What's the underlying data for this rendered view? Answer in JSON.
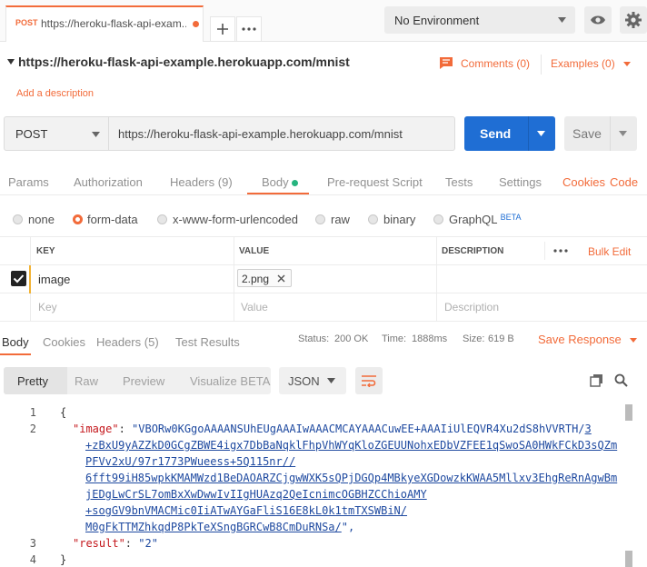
{
  "tabbar": {
    "tab_method": "POST",
    "tab_title": "https://heroku-flask-api-exam...",
    "environment": "No Environment"
  },
  "request": {
    "url_title": "https://heroku-flask-api-example.herokuapp.com/mnist",
    "add_description": "Add a description",
    "comments": "Comments (0)",
    "examples": "Examples (0)",
    "method": "POST",
    "url": "https://heroku-flask-api-example.herokuapp.com/mnist",
    "send": "Send",
    "save": "Save"
  },
  "req_tabs": {
    "params": "Params",
    "authorization": "Authorization",
    "headers": "Headers",
    "headers_count": "(9)",
    "body": "Body",
    "prerequest": "Pre-request Script",
    "tests": "Tests",
    "settings": "Settings",
    "cookies": "Cookies",
    "code": "Code"
  },
  "body_modes": {
    "none": "none",
    "form_data": "form-data",
    "urlencoded": "x-www-form-urlencoded",
    "raw": "raw",
    "binary": "binary",
    "graphql": "GraphQL",
    "beta": "BETA",
    "selected": "form-data"
  },
  "kv_table": {
    "headers": {
      "key": "KEY",
      "value": "VALUE",
      "description": "DESCRIPTION",
      "bulk_edit": "Bulk Edit"
    },
    "rows": [
      {
        "key": "image",
        "value": "2.png",
        "checked": true
      }
    ],
    "placeholder": {
      "key": "Key",
      "value": "Value",
      "description": "Description"
    }
  },
  "response": {
    "tabs": {
      "body": "Body",
      "cookies": "Cookies",
      "headers": "Headers",
      "headers_count": "(5)",
      "test_results": "Test Results"
    },
    "status_label": "Status:",
    "status": "200 OK",
    "time_label": "Time:",
    "time": "1888ms",
    "size_label": "Size:",
    "size": "619 B",
    "save_response": "Save Response",
    "views": {
      "pretty": "Pretty",
      "raw": "Raw",
      "preview": "Preview",
      "visualize": "Visualize",
      "beta": "BETA"
    },
    "format": "JSON"
  },
  "code": {
    "line_numbers": [
      "1",
      "2",
      "3",
      "4"
    ],
    "open_brace": "{",
    "close_brace": "}",
    "image_key": "\"image\"",
    "image_val_first": "\"VBORw0KGgoAAAANSUhEUgAAAIwAAACMCAYAAACuwEE+AAAIiUlEQVR4Xu2dS8hVVRTH/",
    "image_val_first_link": "3",
    "image_val_lines": [
      "+zBxU9yAZZkD0GCgZBWE4igx7DbBaNqklFhpVhWYqKloZGEUUNohxEDbVZFEE1qSwoSA0HWkFCkD3sQZm",
      "PFVv2xU/97r1773PWueess+5Q115nr//",
      "6fft99iH85wpkKMAMWzd1BeDAOARZCjgwWXK5sQPjDGQp4MBkyeXGDowzkKWAA5Mllxv3EhgReRnAgwBm",
      "jEDgLwCrSL7omBxXwDwwIvIIgHUAzq2QeIcnimcOGBHZCChioAMY",
      "+sogGV9bnVMACMic0IiATwAYGaFliS16E8kL0k1tmTXSWBiN/",
      "M0gFkTTMZhkqdP8PkTeXSngBGRCwB8CmDuRNSa/"
    ],
    "image_val_end": "\",",
    "result_key": "\"result\"",
    "result_val": "\"2\""
  },
  "colors": {
    "accent": "#f26b3a",
    "send_blue": "#1f6ed4",
    "status_green": "#26b47f"
  }
}
